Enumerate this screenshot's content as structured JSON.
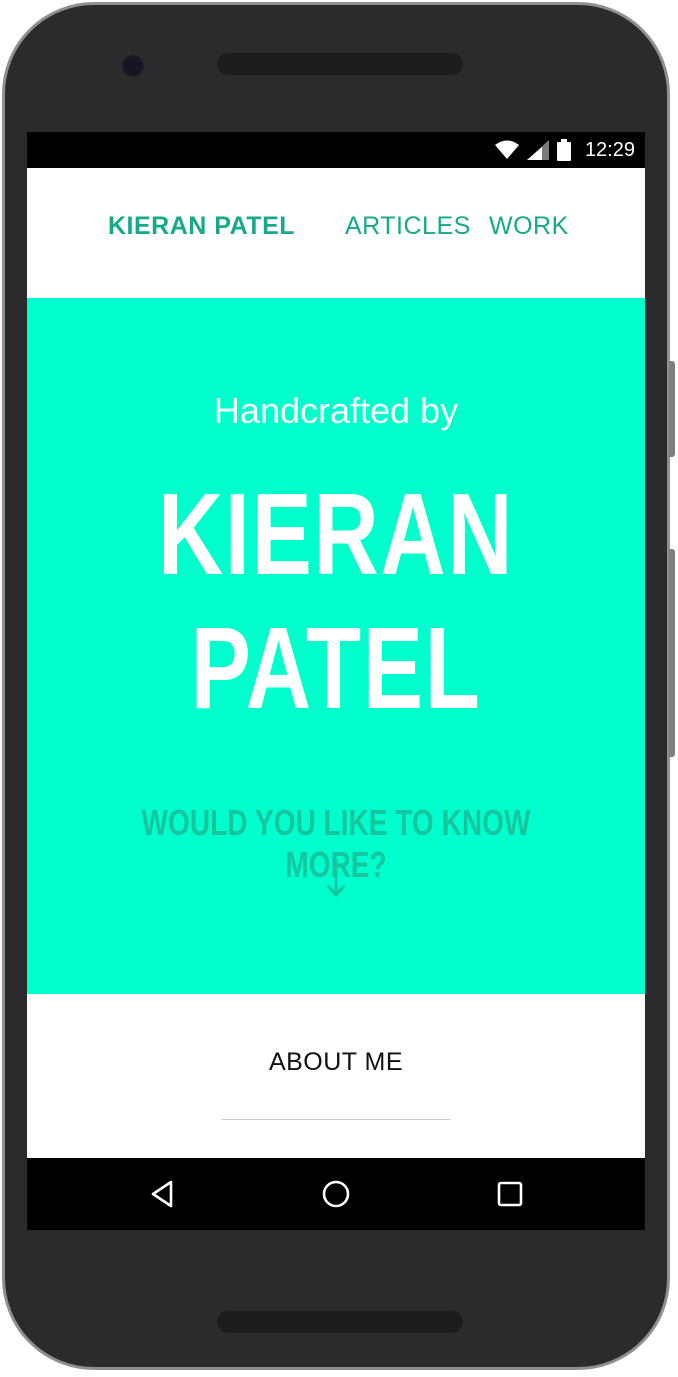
{
  "status_bar": {
    "time": "12:29",
    "icons": [
      "wifi-icon",
      "cell-signal-icon",
      "battery-icon"
    ]
  },
  "nav": {
    "brand": "KIERAN PATEL",
    "links": [
      "ARTICLES",
      "WORK"
    ]
  },
  "hero": {
    "kicker": "Handcrafted by",
    "name_line1": "KIERAN",
    "name_line2": "PATEL",
    "cta": "WOULD YOU LIKE TO KNOW MORE?",
    "arrow_icon": "arrow-down-icon"
  },
  "about": {
    "title": "ABOUT ME"
  },
  "system_nav": {
    "buttons": [
      "back-icon",
      "home-icon",
      "recents-icon"
    ]
  },
  "colors": {
    "accent": "#17a98a",
    "hero_bg": "#00ffcc",
    "cta": "#16c69f"
  }
}
